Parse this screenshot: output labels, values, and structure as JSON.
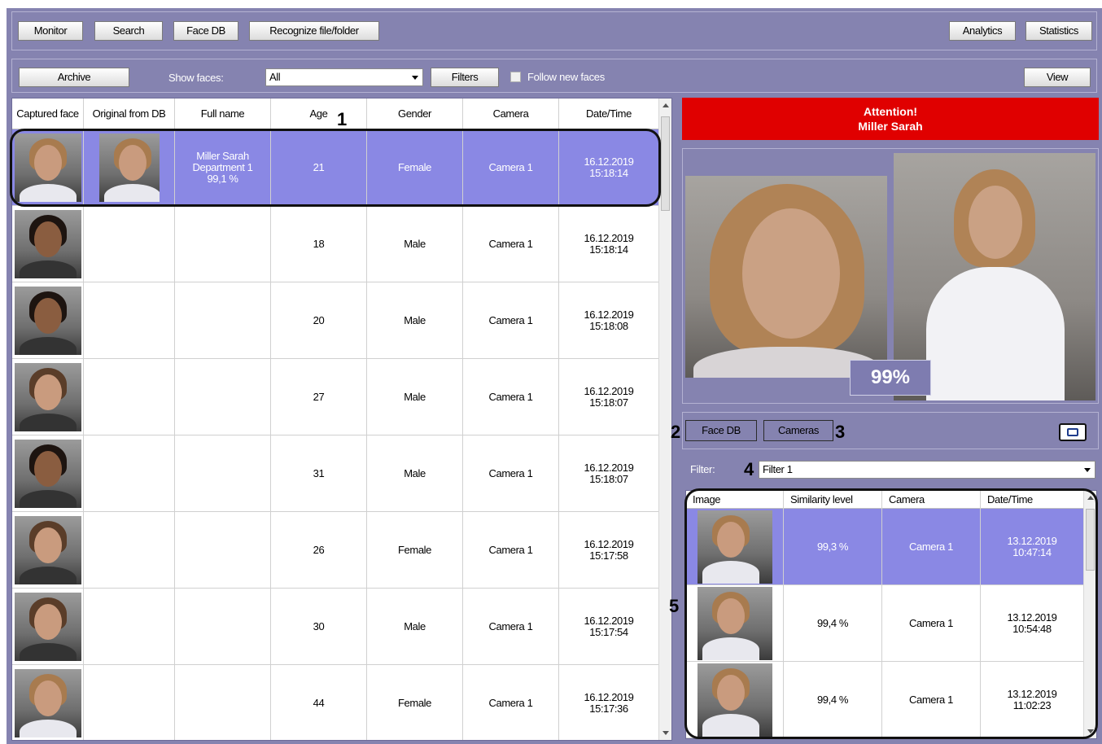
{
  "toolbar": {
    "monitor": "Monitor",
    "search": "Search",
    "face_db": "Face DB",
    "recognize": "Recognize file/folder",
    "analytics": "Analytics",
    "statistics": "Statistics"
  },
  "filterbar": {
    "archive": "Archive",
    "show_faces_label": "Show faces:",
    "show_faces_value": "All",
    "filters": "Filters",
    "follow_new_faces": "Follow new faces",
    "view": "View"
  },
  "table": {
    "columns": [
      "Captured face",
      "Original from DB",
      "Full name",
      "Age",
      "Gender",
      "Camera",
      "Date/Time"
    ],
    "rows": [
      {
        "name": "Miller Sarah",
        "department": "Department 1",
        "score": "99,1 %",
        "age": "21",
        "gender": "Female",
        "camera": "Camera 1",
        "date": "16.12.2019",
        "time": "15:18:14"
      },
      {
        "name": "",
        "department": "",
        "score": "",
        "age": "18",
        "gender": "Male",
        "camera": "Camera 1",
        "date": "16.12.2019",
        "time": "15:18:14"
      },
      {
        "name": "",
        "department": "",
        "score": "",
        "age": "20",
        "gender": "Male",
        "camera": "Camera 1",
        "date": "16.12.2019",
        "time": "15:18:08"
      },
      {
        "name": "",
        "department": "",
        "score": "",
        "age": "27",
        "gender": "Male",
        "camera": "Camera 1",
        "date": "16.12.2019",
        "time": "15:18:07"
      },
      {
        "name": "",
        "department": "",
        "score": "",
        "age": "31",
        "gender": "Male",
        "camera": "Camera 1",
        "date": "16.12.2019",
        "time": "15:18:07"
      },
      {
        "name": "",
        "department": "",
        "score": "",
        "age": "26",
        "gender": "Female",
        "camera": "Camera 1",
        "date": "16.12.2019",
        "time": "15:17:58"
      },
      {
        "name": "",
        "department": "",
        "score": "",
        "age": "30",
        "gender": "Male",
        "camera": "Camera 1",
        "date": "16.12.2019",
        "time": "15:17:54"
      },
      {
        "name": "",
        "department": "",
        "score": "",
        "age": "44",
        "gender": "Female",
        "camera": "Camera 1",
        "date": "16.12.2019",
        "time": "15:17:36"
      }
    ]
  },
  "attention": {
    "line1": "Attention!",
    "line2": "Miller Sarah"
  },
  "match_percent": "99%",
  "subpanel": {
    "face_db": "Face DB",
    "cameras": "Cameras",
    "filter_label": "Filter:",
    "filter_value": "Filter 1"
  },
  "results": {
    "columns": [
      "Image",
      "Similarity level",
      "Camera",
      "Date/Time"
    ],
    "rows": [
      {
        "similarity": "99,3 %",
        "camera": "Camera 1",
        "date": "13.12.2019",
        "time": "10:47:14"
      },
      {
        "similarity": "99,4 %",
        "camera": "Camera 1",
        "date": "13.12.2019",
        "time": "10:54:48"
      },
      {
        "similarity": "99,4 %",
        "camera": "Camera 1",
        "date": "13.12.2019",
        "time": "11:02:23"
      }
    ]
  },
  "callouts": [
    "1",
    "2",
    "3",
    "4",
    "5"
  ],
  "colors": {
    "panel_bg": "#8583b0",
    "selected_row": "#8a88e4",
    "attention_red": "#e00000"
  }
}
